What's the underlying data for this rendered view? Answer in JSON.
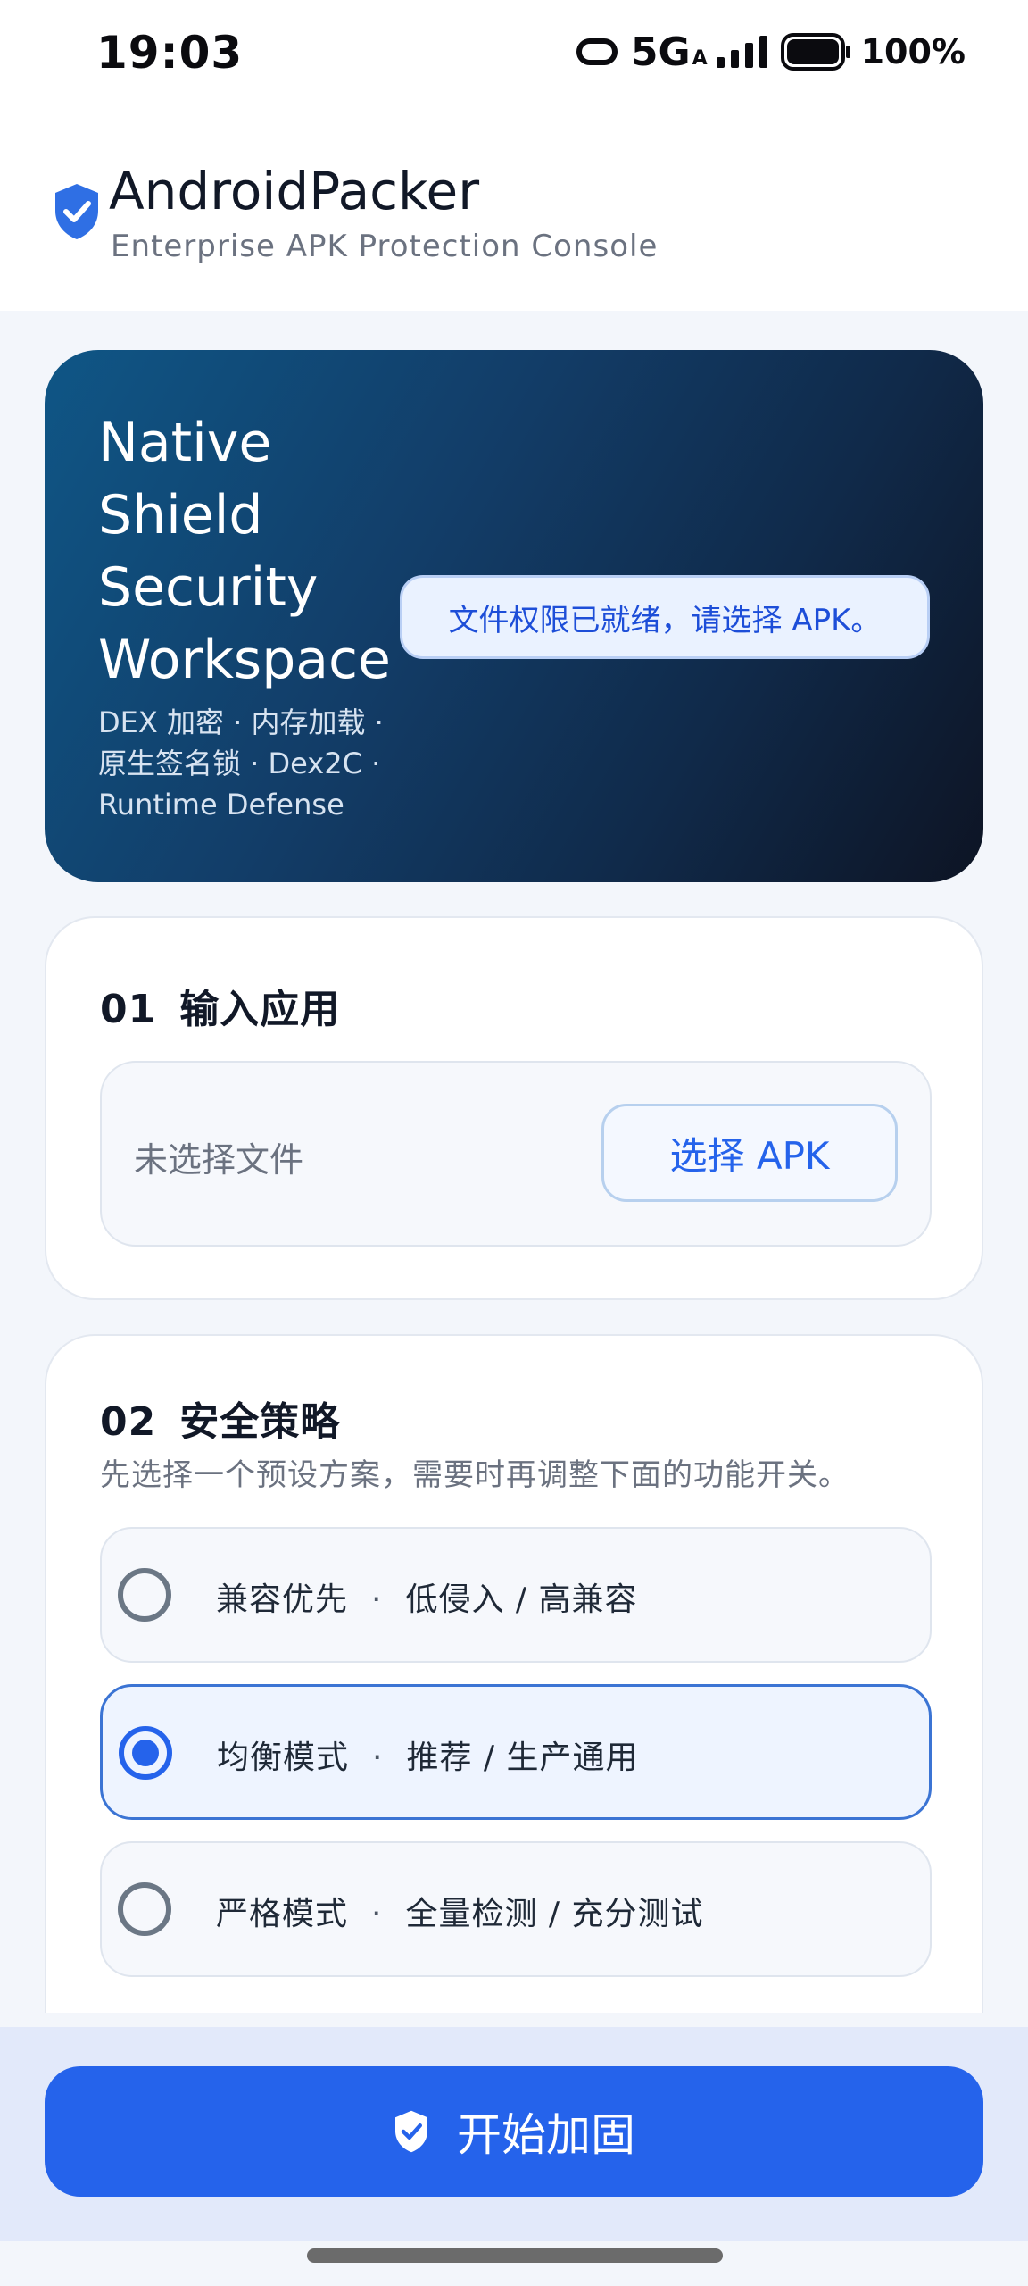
{
  "status_bar": {
    "time": "19:03",
    "network": "5G",
    "network_sub": "A",
    "battery": "100%"
  },
  "header": {
    "title": "AndroidPacker",
    "subtitle": "Enterprise APK Protection Console"
  },
  "hero": {
    "title": "Native Shield Security Workspace",
    "features": "DEX 加密 · 内存加载 · 原生签名锁 · Dex2C · Runtime Defense",
    "status_message": "文件权限已就绪，请选择 APK。"
  },
  "input_section": {
    "number": "01",
    "title": "输入应用",
    "file_status": "未选择文件",
    "pick_button": "选择 APK"
  },
  "policy_section": {
    "number": "02",
    "title": "安全策略",
    "description": "先选择一个预设方案，需要时再调整下面的功能开关。",
    "presets": [
      {
        "name": "兼容优先",
        "detail": "低侵入 / 高兼容",
        "selected": false
      },
      {
        "name": "均衡模式",
        "detail": "推荐 / 生产通用",
        "selected": true
      },
      {
        "name": "严格模式",
        "detail": "全量检测 / 充分测试",
        "selected": false
      }
    ],
    "separator": "·"
  },
  "actions": {
    "start_button": "开始加固"
  },
  "colors": {
    "accent": "#2563eb",
    "hero_start": "#0f5686",
    "hero_end": "#0d1424"
  },
  "icons": {
    "logo": "shield-check-icon",
    "start": "shield-check-icon"
  }
}
